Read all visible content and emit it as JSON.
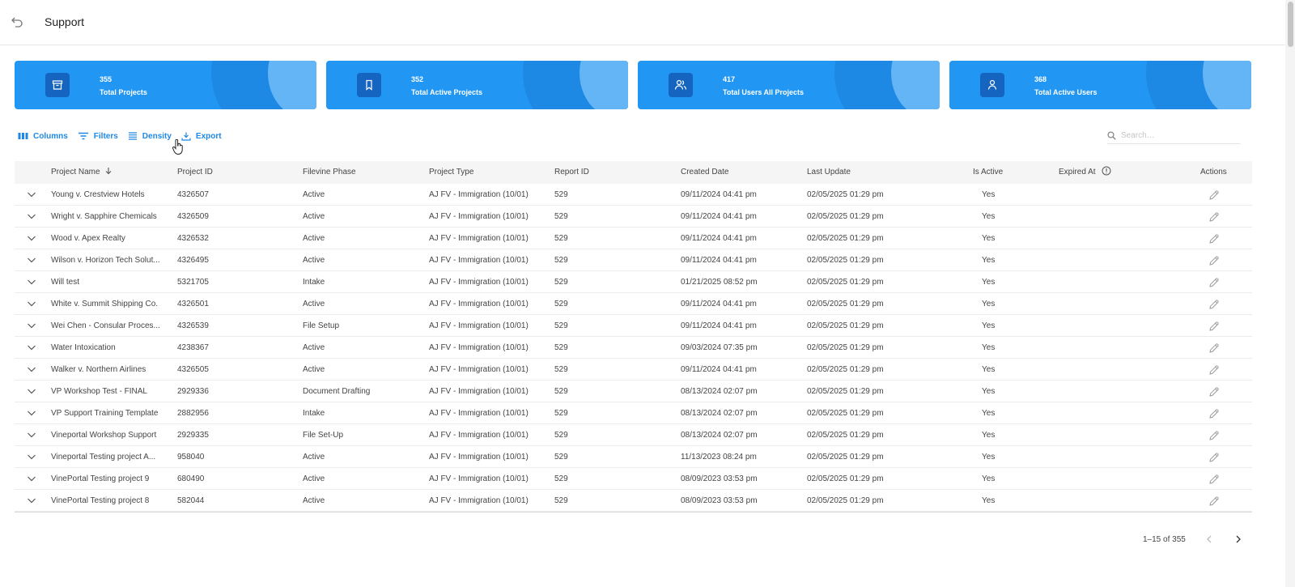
{
  "header": {
    "title": "Support"
  },
  "stats": [
    {
      "value": "355",
      "label": "Total Projects",
      "icon": "archive-icon"
    },
    {
      "value": "352",
      "label": "Total Active Projects",
      "icon": "bookmark-icon"
    },
    {
      "value": "417",
      "label": "Total Users All Projects",
      "icon": "users-icon"
    },
    {
      "value": "368",
      "label": "Total Active Users",
      "icon": "user-icon"
    }
  ],
  "toolbar": {
    "columns": "Columns",
    "filters": "Filters",
    "density": "Density",
    "export": "Export"
  },
  "search": {
    "placeholder": "Search…",
    "value": ""
  },
  "columns": [
    "Project Name",
    "Project ID",
    "Filevine Phase",
    "Project Type",
    "Report ID",
    "Created Date",
    "Last Update",
    "Is Active",
    "Expired At",
    "Actions"
  ],
  "rows": [
    [
      "Young v. Crestview Hotels",
      "4326507",
      "Active",
      "AJ FV - Immigration (10/01)",
      "529",
      "09/11/2024 04:41 pm",
      "02/05/2025 01:29 pm",
      "Yes",
      ""
    ],
    [
      "Wright v. Sapphire Chemicals",
      "4326509",
      "Active",
      "AJ FV - Immigration (10/01)",
      "529",
      "09/11/2024 04:41 pm",
      "02/05/2025 01:29 pm",
      "Yes",
      ""
    ],
    [
      "Wood v. Apex Realty",
      "4326532",
      "Active",
      "AJ FV - Immigration (10/01)",
      "529",
      "09/11/2024 04:41 pm",
      "02/05/2025 01:29 pm",
      "Yes",
      ""
    ],
    [
      "Wilson v. Horizon Tech Solut...",
      "4326495",
      "Active",
      "AJ FV - Immigration (10/01)",
      "529",
      "09/11/2024 04:41 pm",
      "02/05/2025 01:29 pm",
      "Yes",
      ""
    ],
    [
      "Will test",
      "5321705",
      "Intake",
      "AJ FV - Immigration (10/01)",
      "529",
      "01/21/2025 08:52 pm",
      "02/05/2025 01:29 pm",
      "Yes",
      ""
    ],
    [
      "White v. Summit Shipping Co.",
      "4326501",
      "Active",
      "AJ FV - Immigration (10/01)",
      "529",
      "09/11/2024 04:41 pm",
      "02/05/2025 01:29 pm",
      "Yes",
      ""
    ],
    [
      "Wei Chen - Consular Proces...",
      "4326539",
      "File Setup",
      "AJ FV - Immigration (10/01)",
      "529",
      "09/11/2024 04:41 pm",
      "02/05/2025 01:29 pm",
      "Yes",
      ""
    ],
    [
      "Water Intoxication",
      "4238367",
      "Active",
      "AJ FV - Immigration (10/01)",
      "529",
      "09/03/2024 07:35 pm",
      "02/05/2025 01:29 pm",
      "Yes",
      ""
    ],
    [
      "Walker v. Northern Airlines",
      "4326505",
      "Active",
      "AJ FV - Immigration (10/01)",
      "529",
      "09/11/2024 04:41 pm",
      "02/05/2025 01:29 pm",
      "Yes",
      ""
    ],
    [
      "VP Workshop Test - FINAL",
      "2929336",
      "Document Drafting",
      "AJ FV - Immigration (10/01)",
      "529",
      "08/13/2024 02:07 pm",
      "02/05/2025 01:29 pm",
      "Yes",
      ""
    ],
    [
      "VP Support Training Template",
      "2882956",
      "Intake",
      "AJ FV - Immigration (10/01)",
      "529",
      "08/13/2024 02:07 pm",
      "02/05/2025 01:29 pm",
      "Yes",
      ""
    ],
    [
      "Vineportal Workshop Support",
      "2929335",
      "File Set-Up",
      "AJ FV - Immigration (10/01)",
      "529",
      "08/13/2024 02:07 pm",
      "02/05/2025 01:29 pm",
      "Yes",
      ""
    ],
    [
      "Vineportal Testing project A...",
      "958040",
      "Active",
      "AJ FV - Immigration (10/01)",
      "529",
      "11/13/2023 08:24 pm",
      "02/05/2025 01:29 pm",
      "Yes",
      ""
    ],
    [
      "VinePortal Testing project 9",
      "680490",
      "Active",
      "AJ FV - Immigration (10/01)",
      "529",
      "08/09/2023 03:53 pm",
      "02/05/2025 01:29 pm",
      "Yes",
      ""
    ],
    [
      "VinePortal Testing project 8",
      "582044",
      "Active",
      "AJ FV - Immigration (10/01)",
      "529",
      "08/09/2023 03:53 pm",
      "02/05/2025 01:29 pm",
      "Yes",
      ""
    ]
  ],
  "pagination": {
    "label": "1–15 of 355"
  },
  "colors": {
    "accent": "#2196f3",
    "accent_dark": "#1565c0",
    "link": "#1e88e5"
  }
}
